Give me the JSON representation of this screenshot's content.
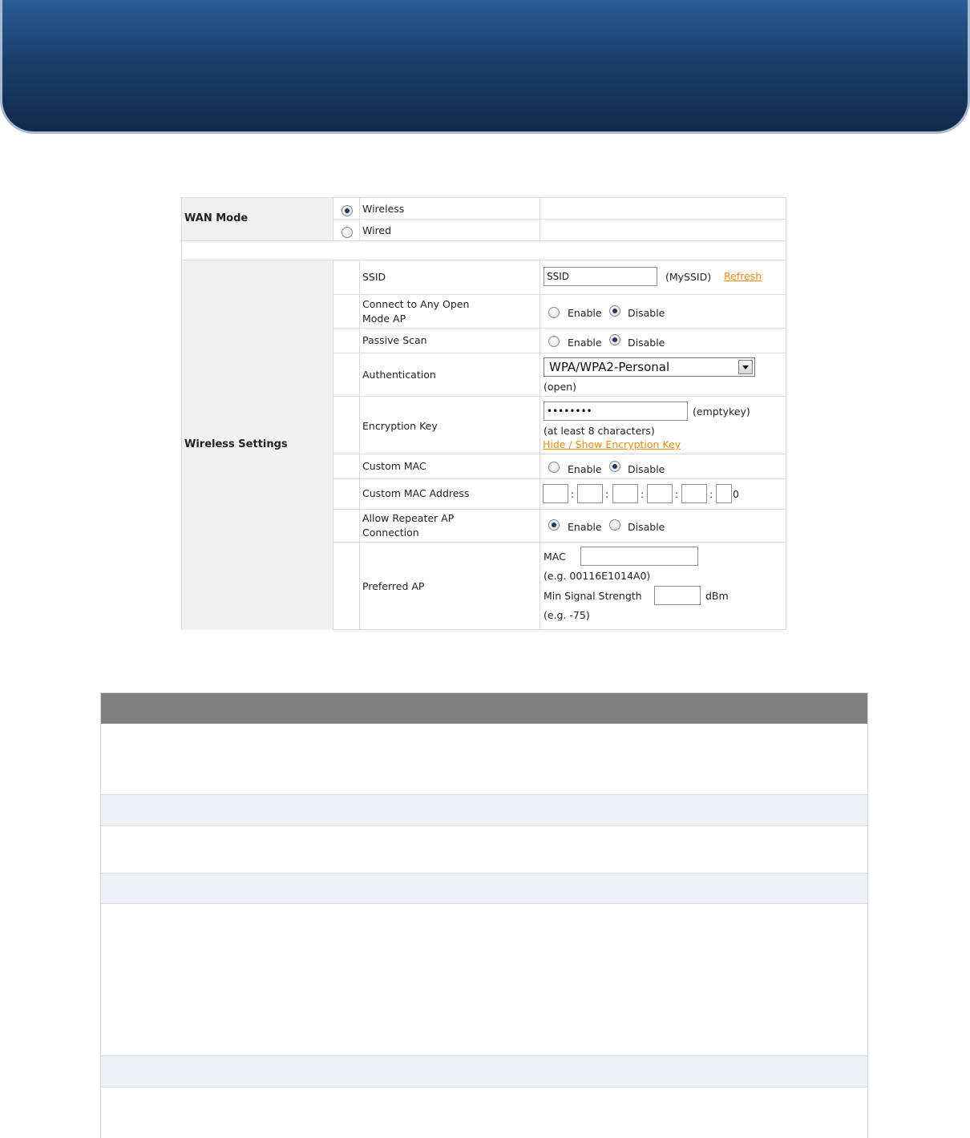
{
  "wan_mode": {
    "label": "WAN Mode",
    "options": [
      {
        "label": "Wireless",
        "selected": true
      },
      {
        "label": "Wired",
        "selected": false
      }
    ]
  },
  "wireless_settings": {
    "label": "Wireless Settings",
    "ssid": {
      "label": "SSID",
      "value": "SSID",
      "hint": "(MySSID)",
      "refresh_link": "Refresh"
    },
    "connect_any": {
      "label_line1": "Connect to Any Open",
      "label_line2": "Mode AP",
      "enable_label": "Enable",
      "disable_label": "Disable",
      "value": "Disable"
    },
    "passive_scan": {
      "label": "Passive Scan",
      "enable_label": "Enable",
      "disable_label": "Disable",
      "value": "Disable"
    },
    "authentication": {
      "label": "Authentication",
      "selected": "WPA/WPA2-Personal",
      "hint": "(open)"
    },
    "encryption_key": {
      "label": "Encryption Key",
      "value": "••••••••",
      "hint": "(emptykey)",
      "note": "(at least 8 characters)",
      "toggle_link": "Hide / Show Encryption Key"
    },
    "custom_mac": {
      "label": "Custom MAC",
      "enable_label": "Enable",
      "disable_label": "Disable",
      "value": "Disable"
    },
    "custom_mac_address": {
      "label": "Custom MAC Address",
      "separator": ":",
      "last_value": "0"
    },
    "allow_repeater": {
      "label_line1": "Allow Repeater AP",
      "label_line2": "Connection",
      "enable_label": "Enable",
      "disable_label": "Disable",
      "value": "Enable"
    },
    "preferred_ap": {
      "label": "Preferred AP",
      "mac_label": "MAC",
      "mac_example": "(e.g. 00116E1014A0)",
      "signal_label": "Min Signal Strength",
      "signal_unit": "dBm",
      "signal_example": "(e.g. -75)"
    }
  }
}
